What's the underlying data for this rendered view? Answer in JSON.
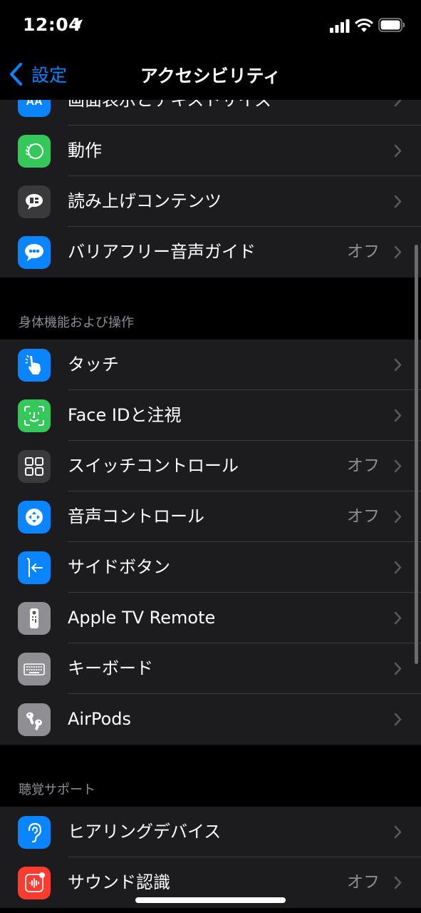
{
  "status_bar": {
    "time": "12:04"
  },
  "nav": {
    "back_label": "設定",
    "title": "アクセシビリティ"
  },
  "sections": {
    "vision_tail": {
      "items": [
        {
          "label": "画面表示とテキストサイズ",
          "value": "",
          "icon": "text-size-icon",
          "color": "#0a84ff"
        },
        {
          "label": "動作",
          "value": "",
          "icon": "motion-icon",
          "color": "#34c759"
        },
        {
          "label": "読み上げコンテンツ",
          "value": "",
          "icon": "spoken-content-icon",
          "color": "#3a3a3c"
        },
        {
          "label": "バリアフリー音声ガイド",
          "value": "オフ",
          "icon": "audio-description-icon",
          "color": "#0a84ff"
        }
      ]
    },
    "physical": {
      "header": "身体機能および操作",
      "items": [
        {
          "label": "タッチ",
          "value": "",
          "icon": "touch-hand-icon",
          "color": "#0a84ff"
        },
        {
          "label": "Face IDと注視",
          "value": "",
          "icon": "face-id-icon",
          "color": "#34c759"
        },
        {
          "label": "スイッチコントロール",
          "value": "オフ",
          "icon": "switch-control-icon",
          "color": "#3a3a3c"
        },
        {
          "label": "音声コントロール",
          "value": "オフ",
          "icon": "voice-control-icon",
          "color": "#0a84ff"
        },
        {
          "label": "サイドボタン",
          "value": "",
          "icon": "side-button-icon",
          "color": "#0a84ff"
        },
        {
          "label": "Apple TV Remote",
          "value": "",
          "icon": "tv-remote-icon",
          "color": "#8e8e93"
        },
        {
          "label": "キーボード",
          "value": "",
          "icon": "keyboard-icon",
          "color": "#8e8e93"
        },
        {
          "label": "AirPods",
          "value": "",
          "icon": "airpods-icon",
          "color": "#8e8e93"
        }
      ]
    },
    "hearing": {
      "header": "聴覚サポート",
      "items": [
        {
          "label": "ヒアリングデバイス",
          "value": "",
          "icon": "ear-icon",
          "color": "#0a84ff"
        },
        {
          "label": "サウンド認識",
          "value": "オフ",
          "icon": "sound-recognition-icon",
          "color": "#ff3b30"
        }
      ]
    }
  }
}
